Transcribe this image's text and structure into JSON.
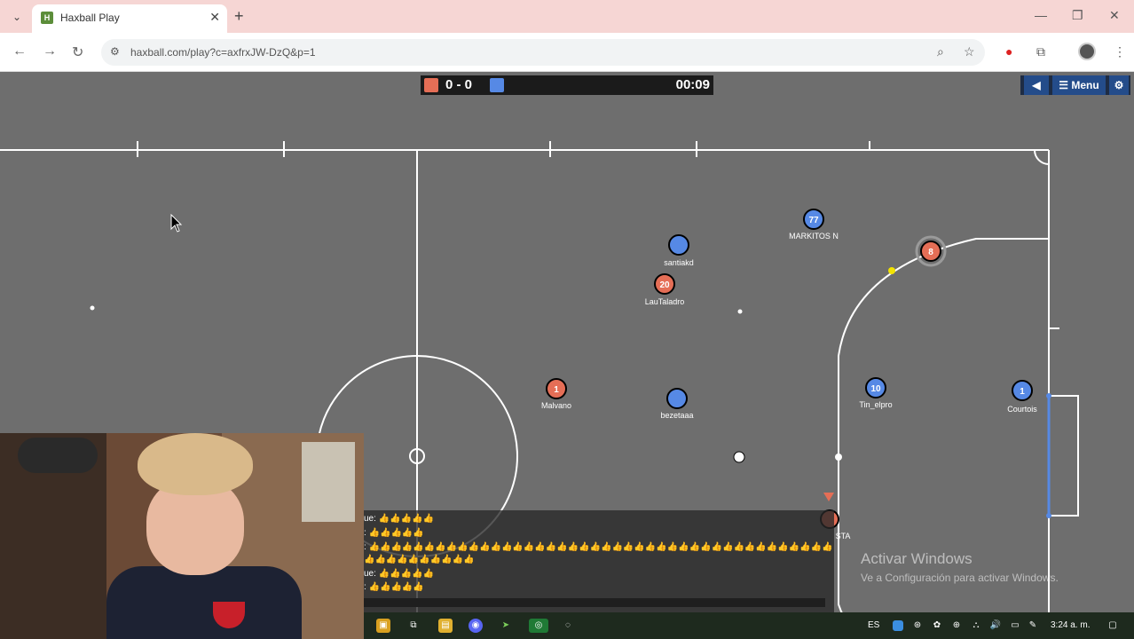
{
  "browser": {
    "tab_title": "Haxball Play",
    "favicon_letter": "H",
    "url": "haxball.com/play?c=axfrxJW-DzQ&p=1"
  },
  "game": {
    "score": "0 - 0",
    "timer": "00:09",
    "menu_label": "Menu",
    "players": [
      {
        "team": "blue",
        "number": "77",
        "name": "MARKITOS N"
      },
      {
        "team": "blue",
        "number": "",
        "name": "santiakd"
      },
      {
        "team": "red",
        "number": "20",
        "name": "LauTaladro"
      },
      {
        "team": "red",
        "number": "8",
        "name": ""
      },
      {
        "team": "red",
        "number": "1",
        "name": "Malvano"
      },
      {
        "team": "blue",
        "number": "",
        "name": "bezetaaa"
      },
      {
        "team": "blue",
        "number": "10",
        "name": "Tin_elpro"
      },
      {
        "team": "blue",
        "number": "1",
        "name": "Courtois"
      },
      {
        "team": "red",
        "number": "",
        "name": "STA"
      }
    ]
  },
  "chat": {
    "lines": [
      "ue: 👍👍👍👍👍",
      ": 👍👍👍👍👍",
      ": 👍👍👍👍👍👍👍👍👍👍👍👍👍👍👍👍👍👍👍👍👍👍👍👍👍👍👍👍👍👍👍👍👍👍👍👍👍👍👍👍👍👍",
      "👍👍👍👍👍👍👍👍👍👍",
      "ue: 👍👍👍👍👍",
      ": 👍👍👍👍👍"
    ]
  },
  "watermark": {
    "title": "Activar Windows",
    "subtitle": "Ve a Configuración para activar Windows."
  },
  "taskbar": {
    "lang": "ES",
    "time": "3:24 a. m."
  },
  "colors": {
    "red_team": "#e56e56",
    "blue_team": "#5689e5",
    "pitch": "#6e6e6e"
  }
}
